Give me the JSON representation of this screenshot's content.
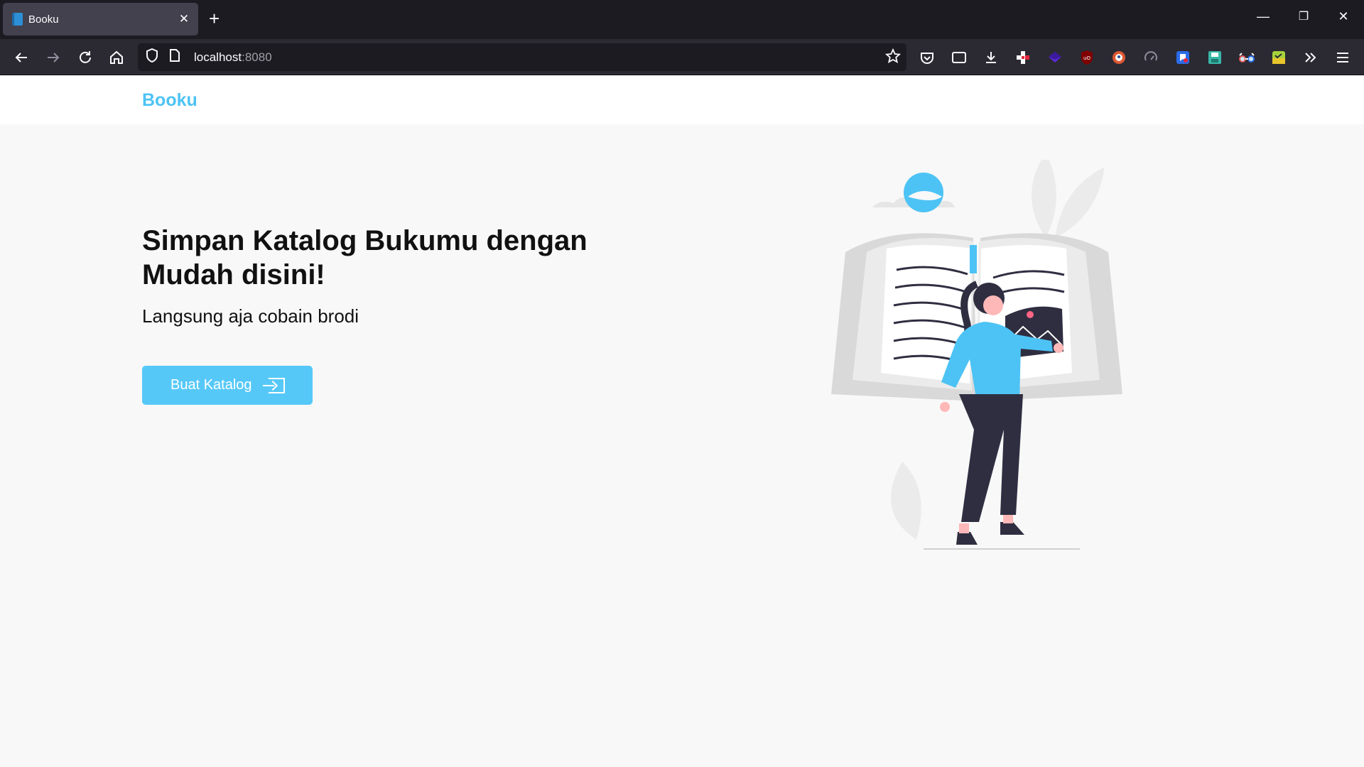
{
  "browser": {
    "tab_title": "Booku",
    "tab_close": "✕",
    "new_tab": "+",
    "url_host": "localhost",
    "url_port": ":8080",
    "window_controls": {
      "minimize": "—",
      "restore": "❐",
      "close": "✕"
    }
  },
  "icons": {
    "back": "arrow-left-icon",
    "forward": "arrow-right-icon",
    "reload": "reload-icon",
    "home": "home-icon",
    "bookmark": "star-icon"
  },
  "extensions": [
    "pocket-icon",
    "reader-view-icon",
    "download-icon",
    "extension-red-cross-icon",
    "extension-purple-icon",
    "ublock-icon",
    "duckduckgo-icon",
    "speed-icon",
    "extension-blue-icon",
    "save-icon",
    "glasses-icon",
    "extension-green-icon"
  ],
  "site": {
    "brand": "Booku",
    "hero_title": "Simpan Katalog Bukumu dengan Mudah disini!",
    "hero_subtitle": "Langsung aja cobain brodi",
    "cta_label": "Buat Katalog"
  },
  "colors": {
    "accent": "#56c8f8",
    "brand": "#4dc3f5",
    "page_bg": "#f8f8f8",
    "chrome_dark": "#1c1b22"
  }
}
